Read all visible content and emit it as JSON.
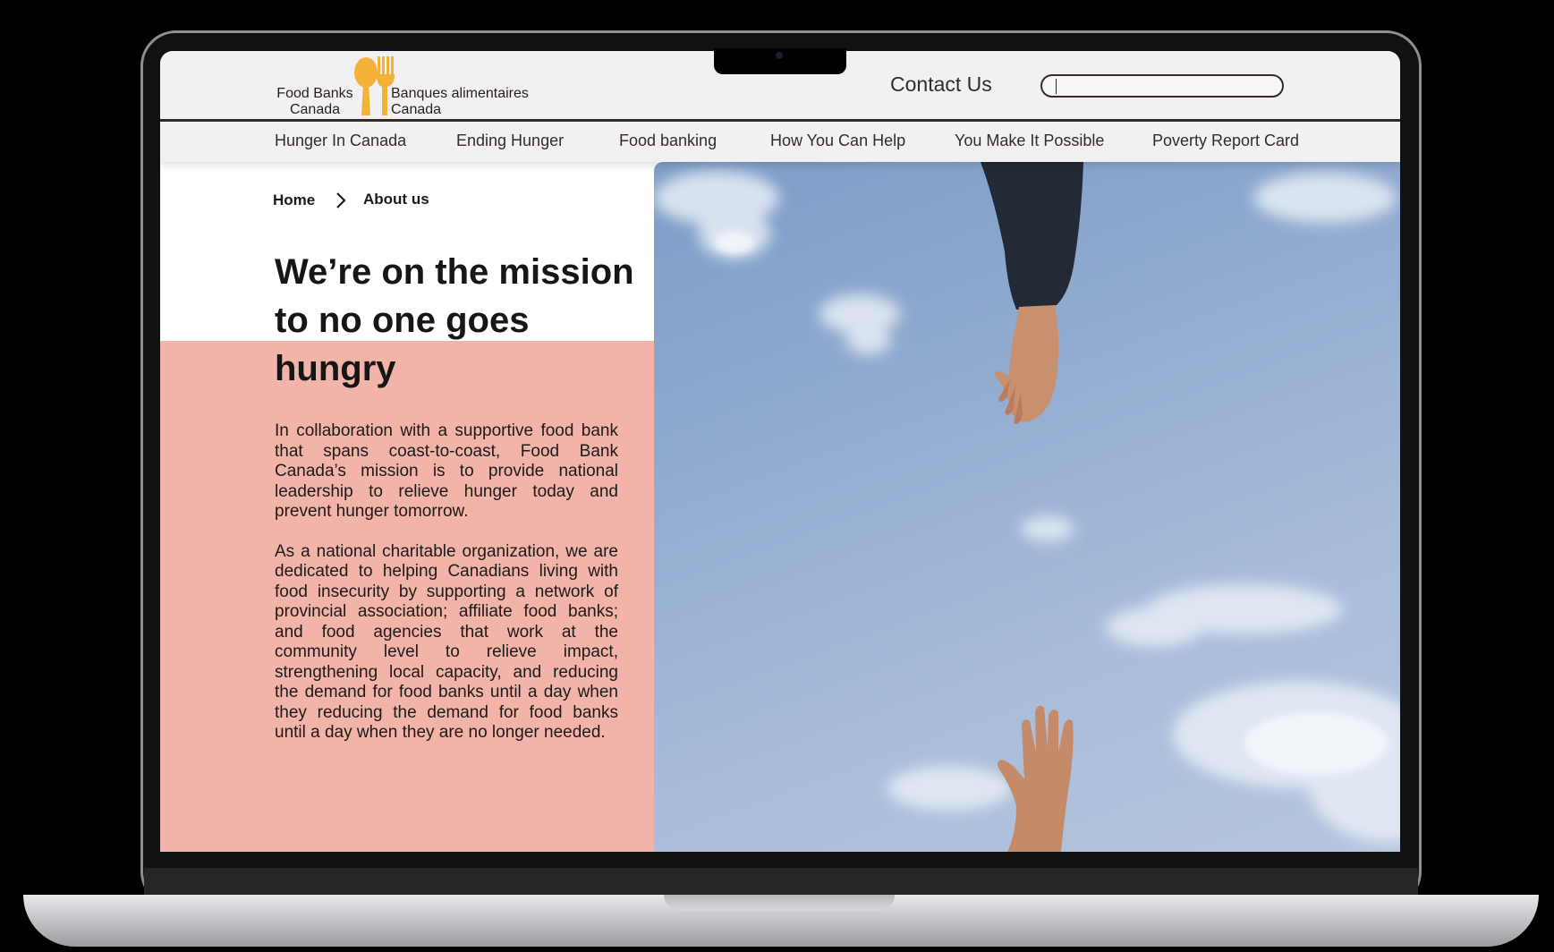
{
  "header": {
    "logo": {
      "en_line1": "Food Banks",
      "en_line2": "Canada",
      "fr_line1": "Banques alimentaires",
      "fr_line2": "Canada",
      "brand_color": "#f2b23a"
    },
    "contact_label": "Contact Us",
    "search": {
      "value": "",
      "placeholder": ""
    }
  },
  "nav": {
    "items": [
      {
        "label": "Hunger In Canada"
      },
      {
        "label": "Ending Hunger"
      },
      {
        "label": "Food banking"
      },
      {
        "label": "How You Can Help"
      },
      {
        "label": "You Make It Possible"
      },
      {
        "label": "Poverty Report Card"
      }
    ]
  },
  "breadcrumb": {
    "home": "Home",
    "current": "About us",
    "separator_icon": "chevron-right-icon"
  },
  "hero": {
    "title": "We’re on the mission to no one goes hungry"
  },
  "body": {
    "paragraph1": "In collaboration with a supportive food bank that spans coast-to-coast, Food Bank Canada’s mission is to provide national leadership to relieve hunger today and prevent hunger tomorrow.",
    "paragraph2": "As a national charitable organization, we are dedicated to helping Canadians living with food insecurity by supporting a network of provincial association; affiliate food banks; and food agencies that work at the community level to relieve impact, strengthening local capacity, and reducing the demand for food banks until a day when they reducing the demand for food banks until a day when they are no longer needed."
  },
  "colors": {
    "accent_panel": "#f2b4a8",
    "text_dark": "#3a2a26",
    "header_bg": "#f1f1f3"
  }
}
